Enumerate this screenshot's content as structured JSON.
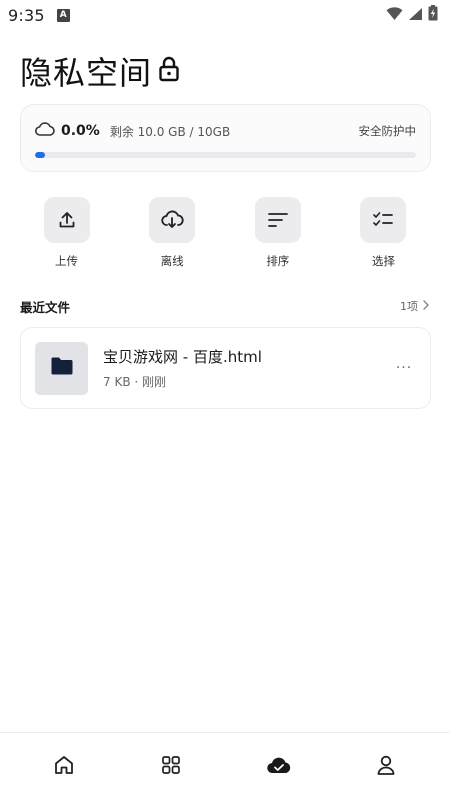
{
  "status_bar": {
    "time": "9:35",
    "notification_badge": "A",
    "icons": [
      "wifi-icon",
      "signal-icon",
      "battery-charging-icon"
    ]
  },
  "page": {
    "title": "隐私空间",
    "title_icon": "lock-icon"
  },
  "storage": {
    "icon": "cloud-icon",
    "percent_text": "0.0%",
    "remaining_text": "剩余 10.0 GB / 10GB",
    "status_text": "安全防护中",
    "used_fraction": 0.0,
    "accent_color": "#1e6fe6"
  },
  "actions": [
    {
      "label": "上传",
      "icon": "upload-icon"
    },
    {
      "label": "离线",
      "icon": "cloud-download-icon"
    },
    {
      "label": "排序",
      "icon": "sort-icon"
    },
    {
      "label": "选择",
      "icon": "checklist-icon"
    }
  ],
  "recent": {
    "title": "最近文件",
    "count_text": "1项",
    "files": [
      {
        "name": "宝贝游戏网 - 百度.html",
        "meta": "7 KB · 刚刚",
        "icon": "folder-icon",
        "more": "···"
      }
    ]
  },
  "bottom_nav": [
    {
      "name": "home",
      "icon": "home-icon"
    },
    {
      "name": "apps",
      "icon": "grid-icon"
    },
    {
      "name": "cloud",
      "icon": "cloud-check-icon",
      "active": true
    },
    {
      "name": "profile",
      "icon": "user-icon"
    }
  ]
}
